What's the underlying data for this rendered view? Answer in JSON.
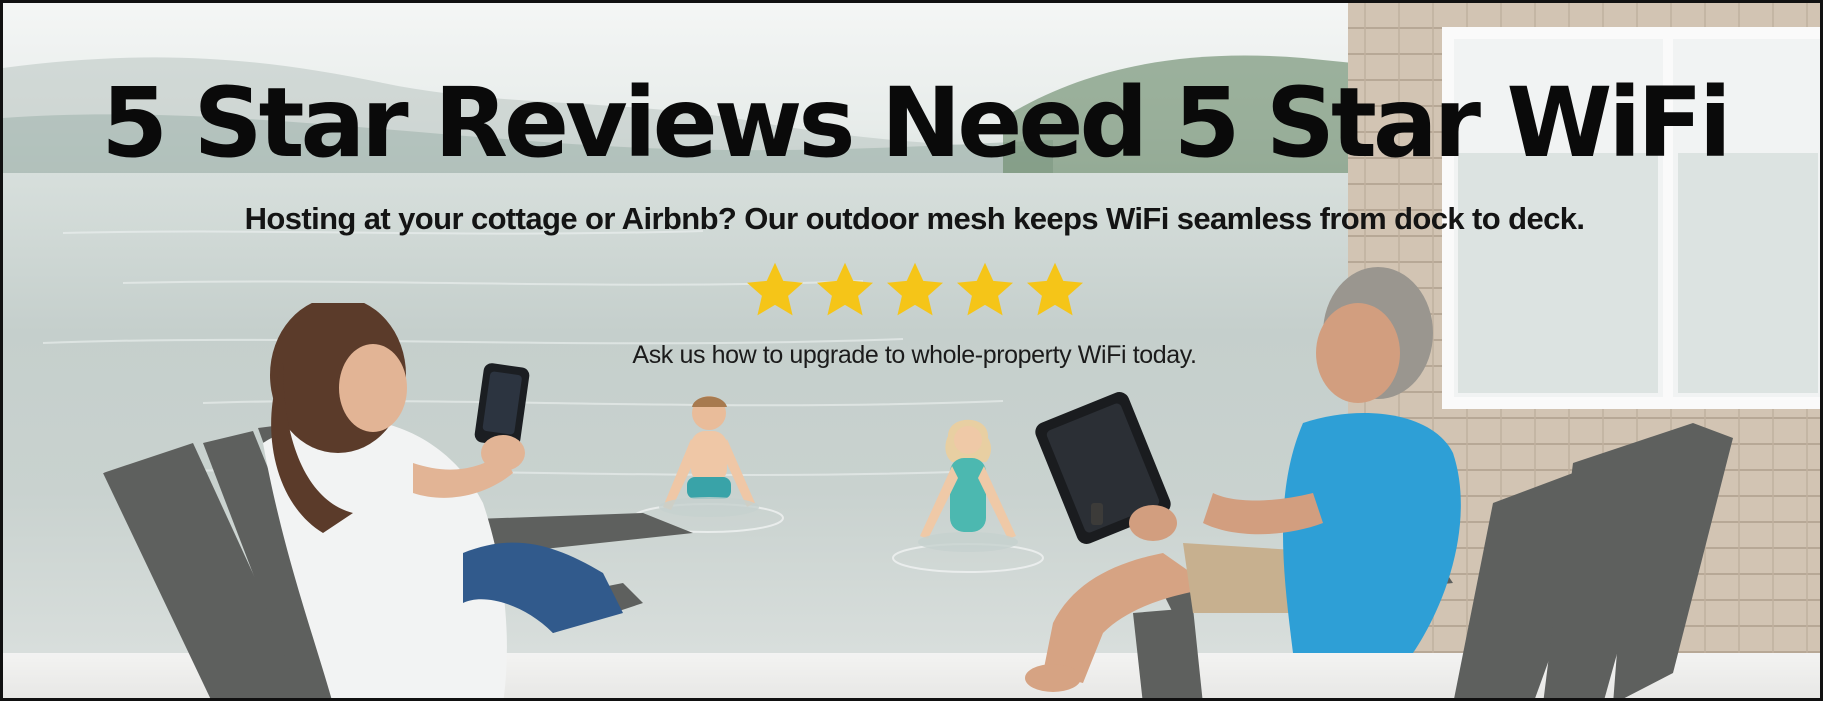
{
  "banner": {
    "headline": "5 Star Reviews Need 5 Star WiFi",
    "subheadline": "Hosting at your cottage or Airbnb? Our outdoor mesh keeps WiFi seamless from dock to deck.",
    "rating": {
      "stars": 5,
      "out_of": 5,
      "color": "#f5c518"
    },
    "cta": "Ask us how to upgrade to whole-property WiFi today."
  },
  "colors": {
    "text": "#0a0a0a",
    "border": "#111111",
    "shirt_blue": "#2e9fd6"
  }
}
